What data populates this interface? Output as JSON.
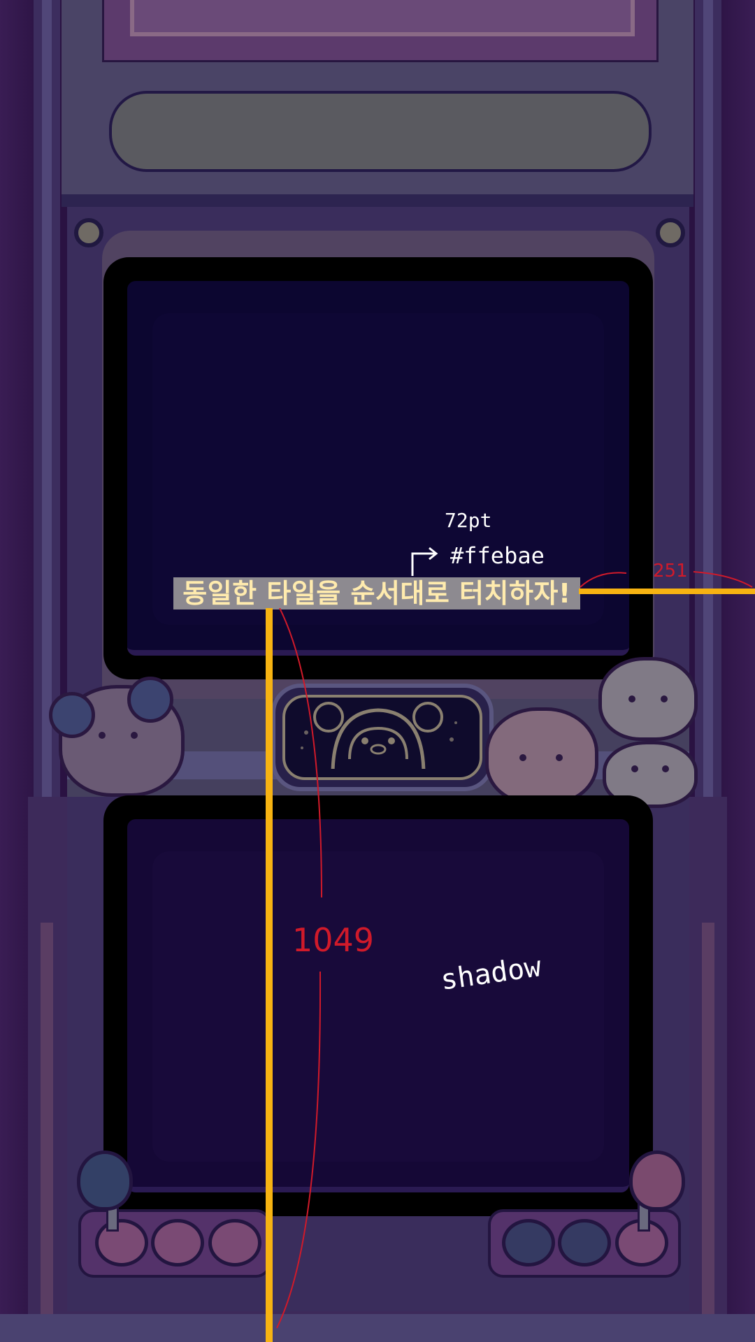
{
  "headline": {
    "text": "동일한 타일을 순서대로 터치하자!"
  },
  "annotations": {
    "font_size": "72pt",
    "color_code": "#ffebae",
    "right_offset": "251",
    "bottom_offset": "1049",
    "effect": "shadow"
  },
  "colors": {
    "headline_text": "#ffebae",
    "guide": "#f7b312",
    "annotation_red": "#d01a2a",
    "screen_panel": "#0c0630"
  },
  "decorations": {
    "characters": [
      "penguin-astronaut",
      "penguin-helmet",
      "hamster",
      "calico-cat",
      "penguin-small"
    ],
    "joysticks": [
      "blue-joystick",
      "pink-joystick"
    ],
    "buttons_left": [
      "pink",
      "pink"
    ],
    "buttons_right": [
      "blue",
      "blue"
    ]
  }
}
